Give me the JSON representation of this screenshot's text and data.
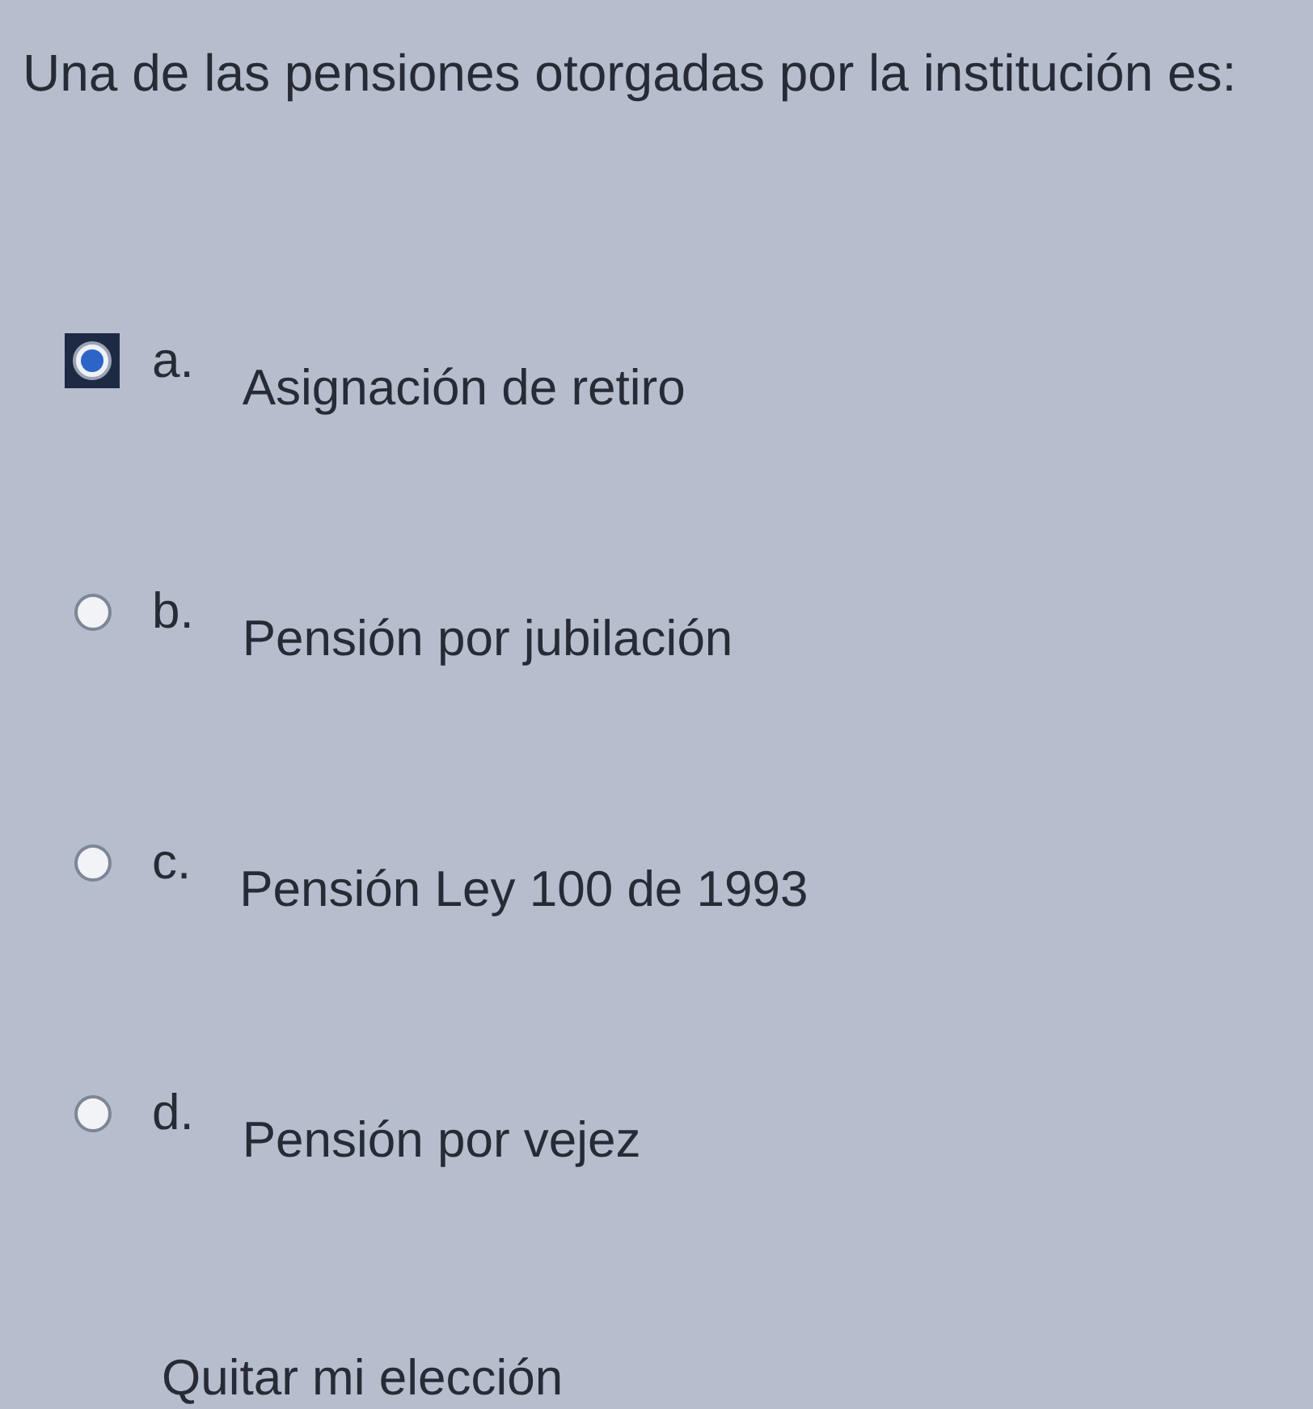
{
  "question": "Una de las pensiones otorgadas por la institución es:",
  "options": [
    {
      "letter": "a.",
      "label": "Asignación de retiro",
      "selected": true
    },
    {
      "letter": "b.",
      "label": "Pensión por jubilación",
      "selected": false
    },
    {
      "letter": "c.",
      "label": "Pensión Ley 100 de 1993",
      "selected": false
    },
    {
      "letter": "d.",
      "label": "Pensión por vejez",
      "selected": false
    }
  ],
  "clear_choice": "Quitar mi elección"
}
